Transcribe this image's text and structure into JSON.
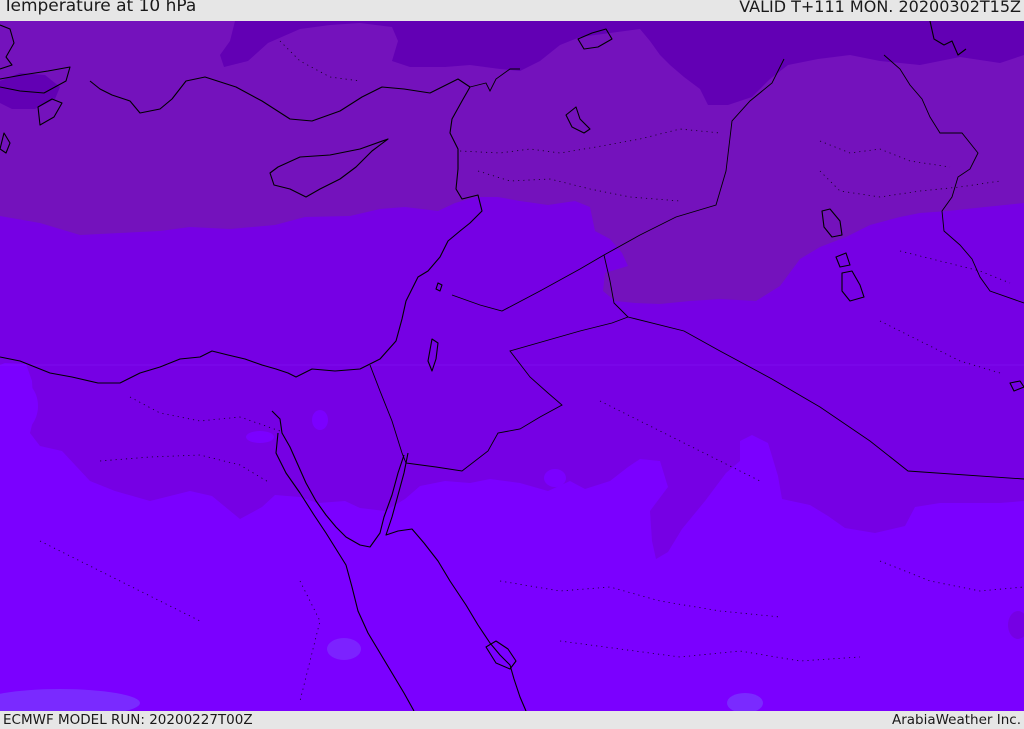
{
  "header": {
    "title": "Temperature at 10 hPa",
    "valid": "VALID T+111 MON. 20200302T15Z"
  },
  "footer": {
    "model_run": "ECMWF MODEL RUN: 20200227T00Z",
    "credit": "ArabiaWeather Inc."
  },
  "colors": {
    "band_darkest": "#6200b4",
    "band_dark": "#7412bc",
    "band_mid": "#7600e4",
    "band_light": "#7b00ff",
    "spot_blue": "#7c22ff",
    "coast": "#000000"
  }
}
